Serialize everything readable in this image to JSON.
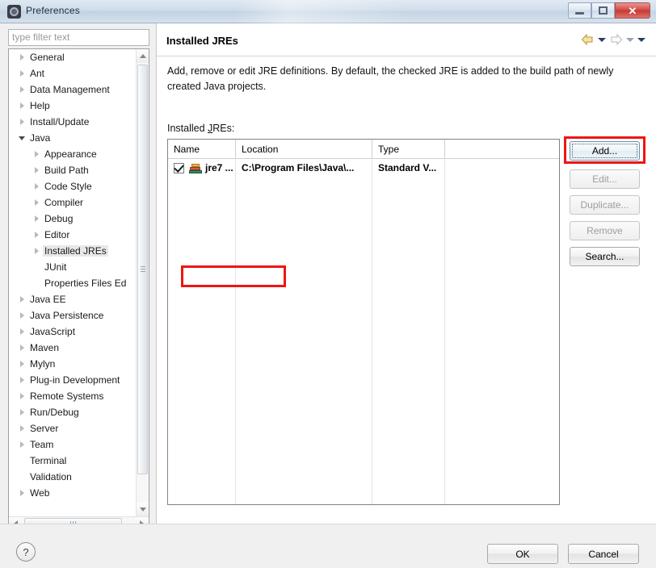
{
  "window": {
    "title": "Preferences",
    "icon": "preferences-gear-icon",
    "controls": {
      "minimize": "minimize-icon",
      "maximize": "restore-icon",
      "close": "✕"
    }
  },
  "sidebar": {
    "filter": {
      "placeholder": "type filter text",
      "value": ""
    },
    "items": [
      {
        "label": "General",
        "level": 0,
        "expandable": true,
        "expanded": false,
        "selected": false
      },
      {
        "label": "Ant",
        "level": 0,
        "expandable": true,
        "expanded": false,
        "selected": false
      },
      {
        "label": "Data Management",
        "level": 0,
        "expandable": true,
        "expanded": false,
        "selected": false
      },
      {
        "label": "Help",
        "level": 0,
        "expandable": true,
        "expanded": false,
        "selected": false
      },
      {
        "label": "Install/Update",
        "level": 0,
        "expandable": true,
        "expanded": false,
        "selected": false
      },
      {
        "label": "Java",
        "level": 0,
        "expandable": true,
        "expanded": true,
        "selected": false
      },
      {
        "label": "Appearance",
        "level": 1,
        "expandable": true,
        "expanded": false,
        "selected": false
      },
      {
        "label": "Build Path",
        "level": 1,
        "expandable": true,
        "expanded": false,
        "selected": false
      },
      {
        "label": "Code Style",
        "level": 1,
        "expandable": true,
        "expanded": false,
        "selected": false
      },
      {
        "label": "Compiler",
        "level": 1,
        "expandable": true,
        "expanded": false,
        "selected": false
      },
      {
        "label": "Debug",
        "level": 1,
        "expandable": true,
        "expanded": false,
        "selected": false
      },
      {
        "label": "Editor",
        "level": 1,
        "expandable": true,
        "expanded": false,
        "selected": false
      },
      {
        "label": "Installed JREs",
        "level": 1,
        "expandable": true,
        "expanded": false,
        "selected": true
      },
      {
        "label": "JUnit",
        "level": 1,
        "expandable": false,
        "expanded": false,
        "selected": false
      },
      {
        "label": "Properties Files Ed",
        "level": 1,
        "expandable": false,
        "expanded": false,
        "selected": false
      },
      {
        "label": "Java EE",
        "level": 0,
        "expandable": true,
        "expanded": false,
        "selected": false
      },
      {
        "label": "Java Persistence",
        "level": 0,
        "expandable": true,
        "expanded": false,
        "selected": false
      },
      {
        "label": "JavaScript",
        "level": 0,
        "expandable": true,
        "expanded": false,
        "selected": false
      },
      {
        "label": "Maven",
        "level": 0,
        "expandable": true,
        "expanded": false,
        "selected": false
      },
      {
        "label": "Mylyn",
        "level": 0,
        "expandable": true,
        "expanded": false,
        "selected": false
      },
      {
        "label": "Plug-in Development",
        "level": 0,
        "expandable": true,
        "expanded": false,
        "selected": false
      },
      {
        "label": "Remote Systems",
        "level": 0,
        "expandable": true,
        "expanded": false,
        "selected": false
      },
      {
        "label": "Run/Debug",
        "level": 0,
        "expandable": true,
        "expanded": false,
        "selected": false
      },
      {
        "label": "Server",
        "level": 0,
        "expandable": true,
        "expanded": false,
        "selected": false
      },
      {
        "label": "Team",
        "level": 0,
        "expandable": true,
        "expanded": false,
        "selected": false
      },
      {
        "label": "Terminal",
        "level": 0,
        "expandable": false,
        "expanded": false,
        "selected": false
      },
      {
        "label": "Validation",
        "level": 0,
        "expandable": false,
        "expanded": false,
        "selected": false
      },
      {
        "label": "Web",
        "level": 0,
        "expandable": true,
        "expanded": false,
        "selected": false
      }
    ]
  },
  "main": {
    "title": "Installed JREs",
    "description": "Add, remove or edit JRE definitions. By default, the checked JRE is added to the build path of newly created Java projects.",
    "list_label_pre": "Installed ",
    "list_label_key": "J",
    "list_label_post": "REs:",
    "nav": {
      "back_icon": "back-arrow-icon",
      "back_dropdown_icon": "caret-down-icon",
      "forward_icon": "forward-arrow-icon",
      "forward_dropdown_icon": "caret-down-icon",
      "menu_icon": "caret-down-icon"
    },
    "table": {
      "columns": [
        "Name",
        "Location",
        "Type",
        ""
      ],
      "rows": [
        {
          "checked": true,
          "icon": "jre-library-icon",
          "name": "jre7 ...",
          "location": "C:\\Program Files\\Java\\...",
          "type": "Standard V...",
          "extra": ""
        }
      ]
    },
    "buttons": [
      {
        "id": "add",
        "label": "Add...",
        "key": "A",
        "enabled": true,
        "focused": true
      },
      {
        "id": "edit",
        "label": "Edit...",
        "key": "E",
        "enabled": false,
        "focused": false
      },
      {
        "id": "duplicate",
        "label": "Duplicate...",
        "key": "c",
        "enabled": false,
        "focused": false
      },
      {
        "id": "remove",
        "label": "Remove",
        "key": "R",
        "enabled": false,
        "focused": false
      },
      {
        "id": "search",
        "label": "Search...",
        "key": "S",
        "enabled": true,
        "focused": false
      }
    ]
  },
  "footer": {
    "help_icon": "?",
    "ok_label": "OK",
    "cancel_label": "Cancel"
  },
  "annotations": {
    "highlight_color": "#f01414",
    "boxes": [
      "installed-jres-tree-item",
      "add-button"
    ]
  }
}
